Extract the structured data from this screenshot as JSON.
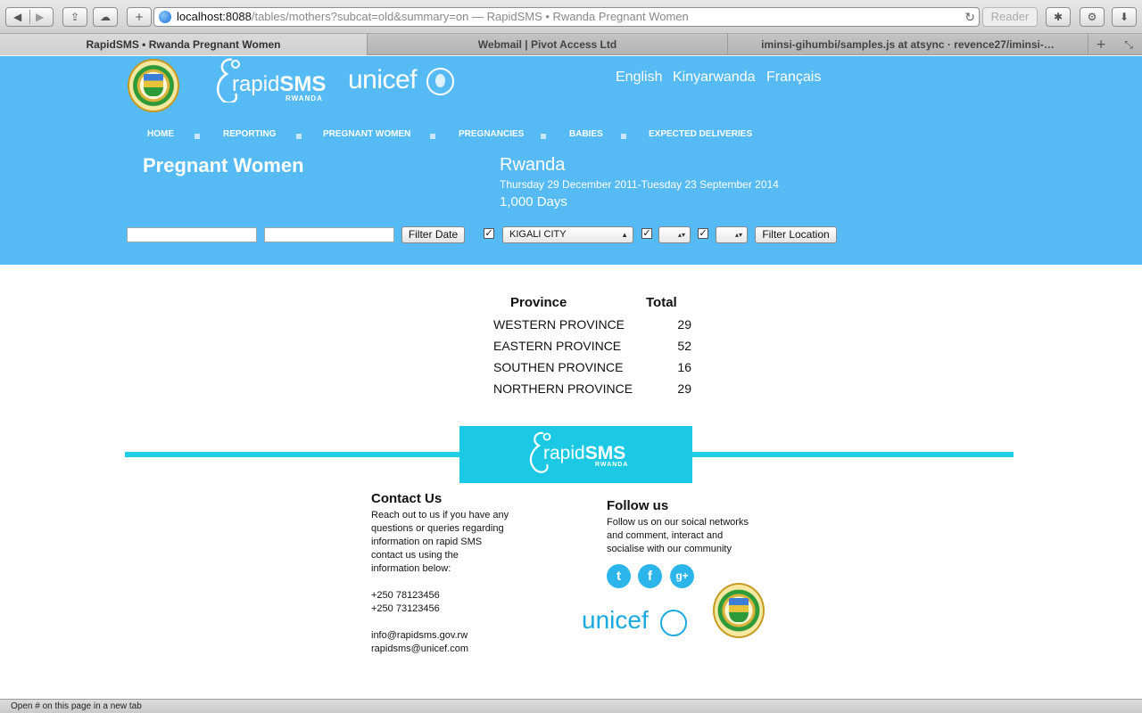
{
  "browser": {
    "url_host": "localhost:8088",
    "url_path": "/tables/mothers?subcat=old&summary=on",
    "url_separator": "—",
    "page_title": "RapidSMS • Rwanda Pregnant Women",
    "reader_label": "Reader",
    "tabs": [
      {
        "label": "RapidSMS • Rwanda Pregnant Women"
      },
      {
        "label": "Webmail | Pivot Access Ltd"
      },
      {
        "label": "iminsi-gihumbi/samples.js at atsync · revence27/iminsi-…"
      }
    ],
    "status_text": "Open # on this page in a new tab"
  },
  "header": {
    "rapidsms_logo": {
      "brand_light": "rapid",
      "brand_bold": "SMS",
      "sub": "RWANDA"
    },
    "unicef_logo": "unicef",
    "languages": [
      "English",
      "Kinyarwanda",
      "Français"
    ],
    "nav": [
      "HOME",
      "REPORTING",
      "PREGNANT WOMEN",
      "PREGNANCIES",
      "BABIES",
      "EXPECTED DELIVERIES"
    ],
    "page_title": "Pregnant Women",
    "region": "Rwanda",
    "date_range": "Thursday 29 December 2011-Tuesday 23 September 2014",
    "days": "1,000 Days"
  },
  "filters": {
    "start_date": "",
    "end_date": "",
    "filter_date_label": "Filter Date",
    "province_checked": true,
    "province_selected": "KIGALI CITY",
    "district_checked": true,
    "district_selected": "",
    "sector_checked": true,
    "sector_selected": "",
    "filter_location_label": "Filter Location",
    "check_glyph": "✓"
  },
  "table": {
    "headers": [
      "Province",
      "Total"
    ],
    "rows": [
      {
        "name": "WESTERN PROVINCE",
        "total": "29"
      },
      {
        "name": "EASTERN PROVINCE",
        "total": "52"
      },
      {
        "name": "SOUTHEN PROVINCE",
        "total": "16"
      },
      {
        "name": "NORTHERN PROVINCE",
        "total": "29"
      }
    ]
  },
  "footer": {
    "rapidsms_logo": {
      "brand_light": "rapid",
      "brand_bold": "SMS",
      "sub": "RWANDA"
    },
    "contact": {
      "heading": "Contact Us",
      "lines": [
        "Reach out to us if you have any",
        "questions or queries regarding",
        "information on rapid SMS",
        "contact us using the",
        "information below:"
      ],
      "phones": [
        "+250 78123456",
        "+250 73123456"
      ],
      "emails": [
        "info@rapidsms.gov.rw",
        "rapidsms@unicef.com"
      ]
    },
    "follow": {
      "heading": "Follow us",
      "lines": [
        "Follow us on our soical networks",
        "and comment, interact and",
        "socialise with our community"
      ],
      "social_icons": [
        "twitter-icon",
        "facebook-icon",
        "google-plus-icon"
      ],
      "social_glyphs": [
        "t",
        "f",
        "g+"
      ]
    },
    "unicef_logo": "unicef"
  },
  "colors": {
    "header_bg": "#56baf5",
    "footer_accent": "#20cde6",
    "unicef_blue": "#1aa9df"
  }
}
